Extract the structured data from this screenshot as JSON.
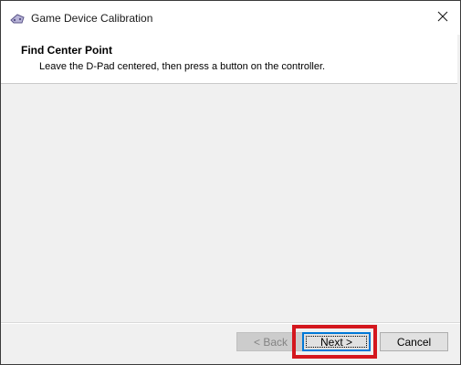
{
  "window": {
    "title": "Game Device Calibration",
    "app_icon": "gamepad-icon",
    "close_icon": "close-icon"
  },
  "header": {
    "title": "Find Center Point",
    "subtitle": "Leave the D-Pad centered, then press a button on the controller."
  },
  "footer": {
    "back_label": "< Back",
    "next_label": "Next >",
    "cancel_label": "Cancel",
    "back_enabled": false
  },
  "colors": {
    "highlight": "#d4171e",
    "focus_border": "#0078d7",
    "panel_bg": "#f0f0f0"
  }
}
